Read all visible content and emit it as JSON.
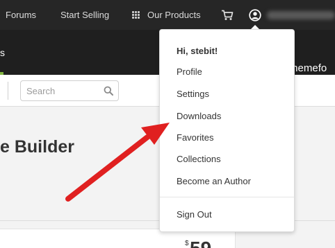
{
  "topnav": {
    "links": [
      "Forums",
      "Start Selling",
      "Our Products"
    ]
  },
  "subnav": {
    "active_tab_fragment": "s",
    "brand_fragment": "themefo"
  },
  "search": {
    "placeholder": "Search"
  },
  "page": {
    "title_fragment": "e Builder",
    "price_currency": "$",
    "price_fragment": "59"
  },
  "user_menu": {
    "greeting": "Hi, stebit!",
    "items": [
      "Profile",
      "Settings",
      "Downloads",
      "Favorites",
      "Collections",
      "Become an Author"
    ],
    "sign_out": "Sign Out"
  },
  "colors": {
    "topnav_bg": "#262626",
    "subnav_bg": "#1f1f1f",
    "accent_green": "#82b541",
    "annotation_red": "#e02020"
  },
  "icons": [
    "grid-icon",
    "cart-icon",
    "user-icon",
    "search-icon",
    "arrow-annotation-icon"
  ]
}
